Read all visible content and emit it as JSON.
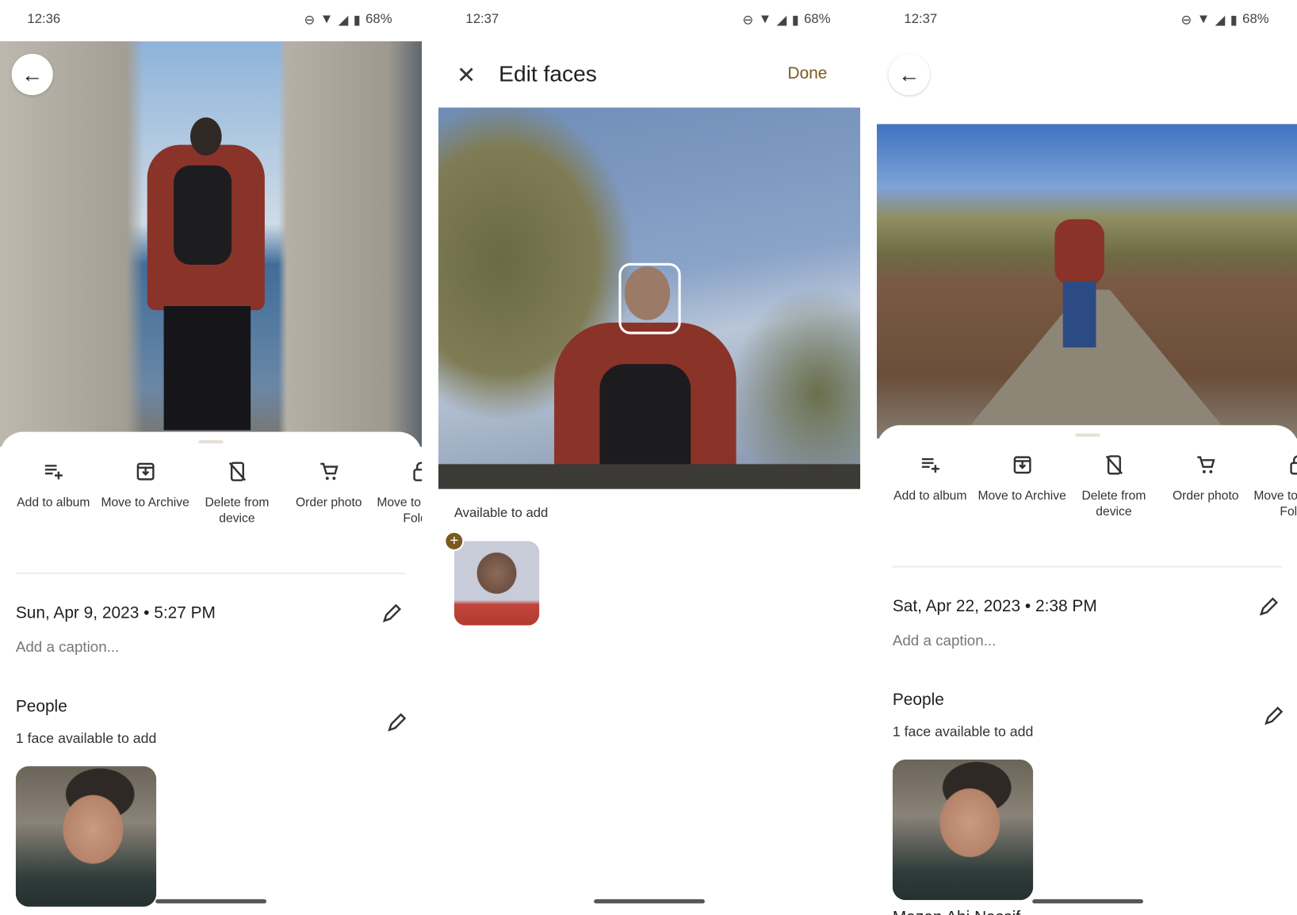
{
  "panels": [
    {
      "status": {
        "time": "12:36",
        "battery": "68%"
      },
      "actions": [
        "Add to album",
        "Move to Archive",
        "Delete from device",
        "Order photo",
        "Move to Locked Folder"
      ],
      "date": "Sun, Apr 9, 2023",
      "time": "5:27 PM",
      "caption_placeholder": "Add a caption...",
      "people_title": "People",
      "people_sub": "1 face available to add"
    },
    {
      "status": {
        "time": "12:37",
        "battery": "68%"
      },
      "title": "Edit faces",
      "done": "Done",
      "available_label": "Available to add"
    },
    {
      "status": {
        "time": "12:37",
        "battery": "68%"
      },
      "actions": [
        "Add to album",
        "Move to Archive",
        "Delete from device",
        "Order photo",
        "Move to Locked Folder"
      ],
      "date": "Sat, Apr 22, 2023",
      "time": "2:38 PM",
      "caption_placeholder": "Add a caption...",
      "people_title": "People",
      "people_sub": "1 face available to add",
      "person_name": "Mazen Abi Nassif"
    }
  ],
  "colors": {
    "accent": "#7a5a1e",
    "add_badge": "#7a5a1e"
  },
  "icons": [
    "dnd-icon",
    "wifi-icon",
    "signal-icon",
    "battery-icon",
    "back-arrow-icon",
    "close-icon",
    "playlist-add-icon",
    "archive-icon",
    "phone-off-icon",
    "cart-icon",
    "lock-icon",
    "pencil-icon",
    "plus-icon"
  ]
}
